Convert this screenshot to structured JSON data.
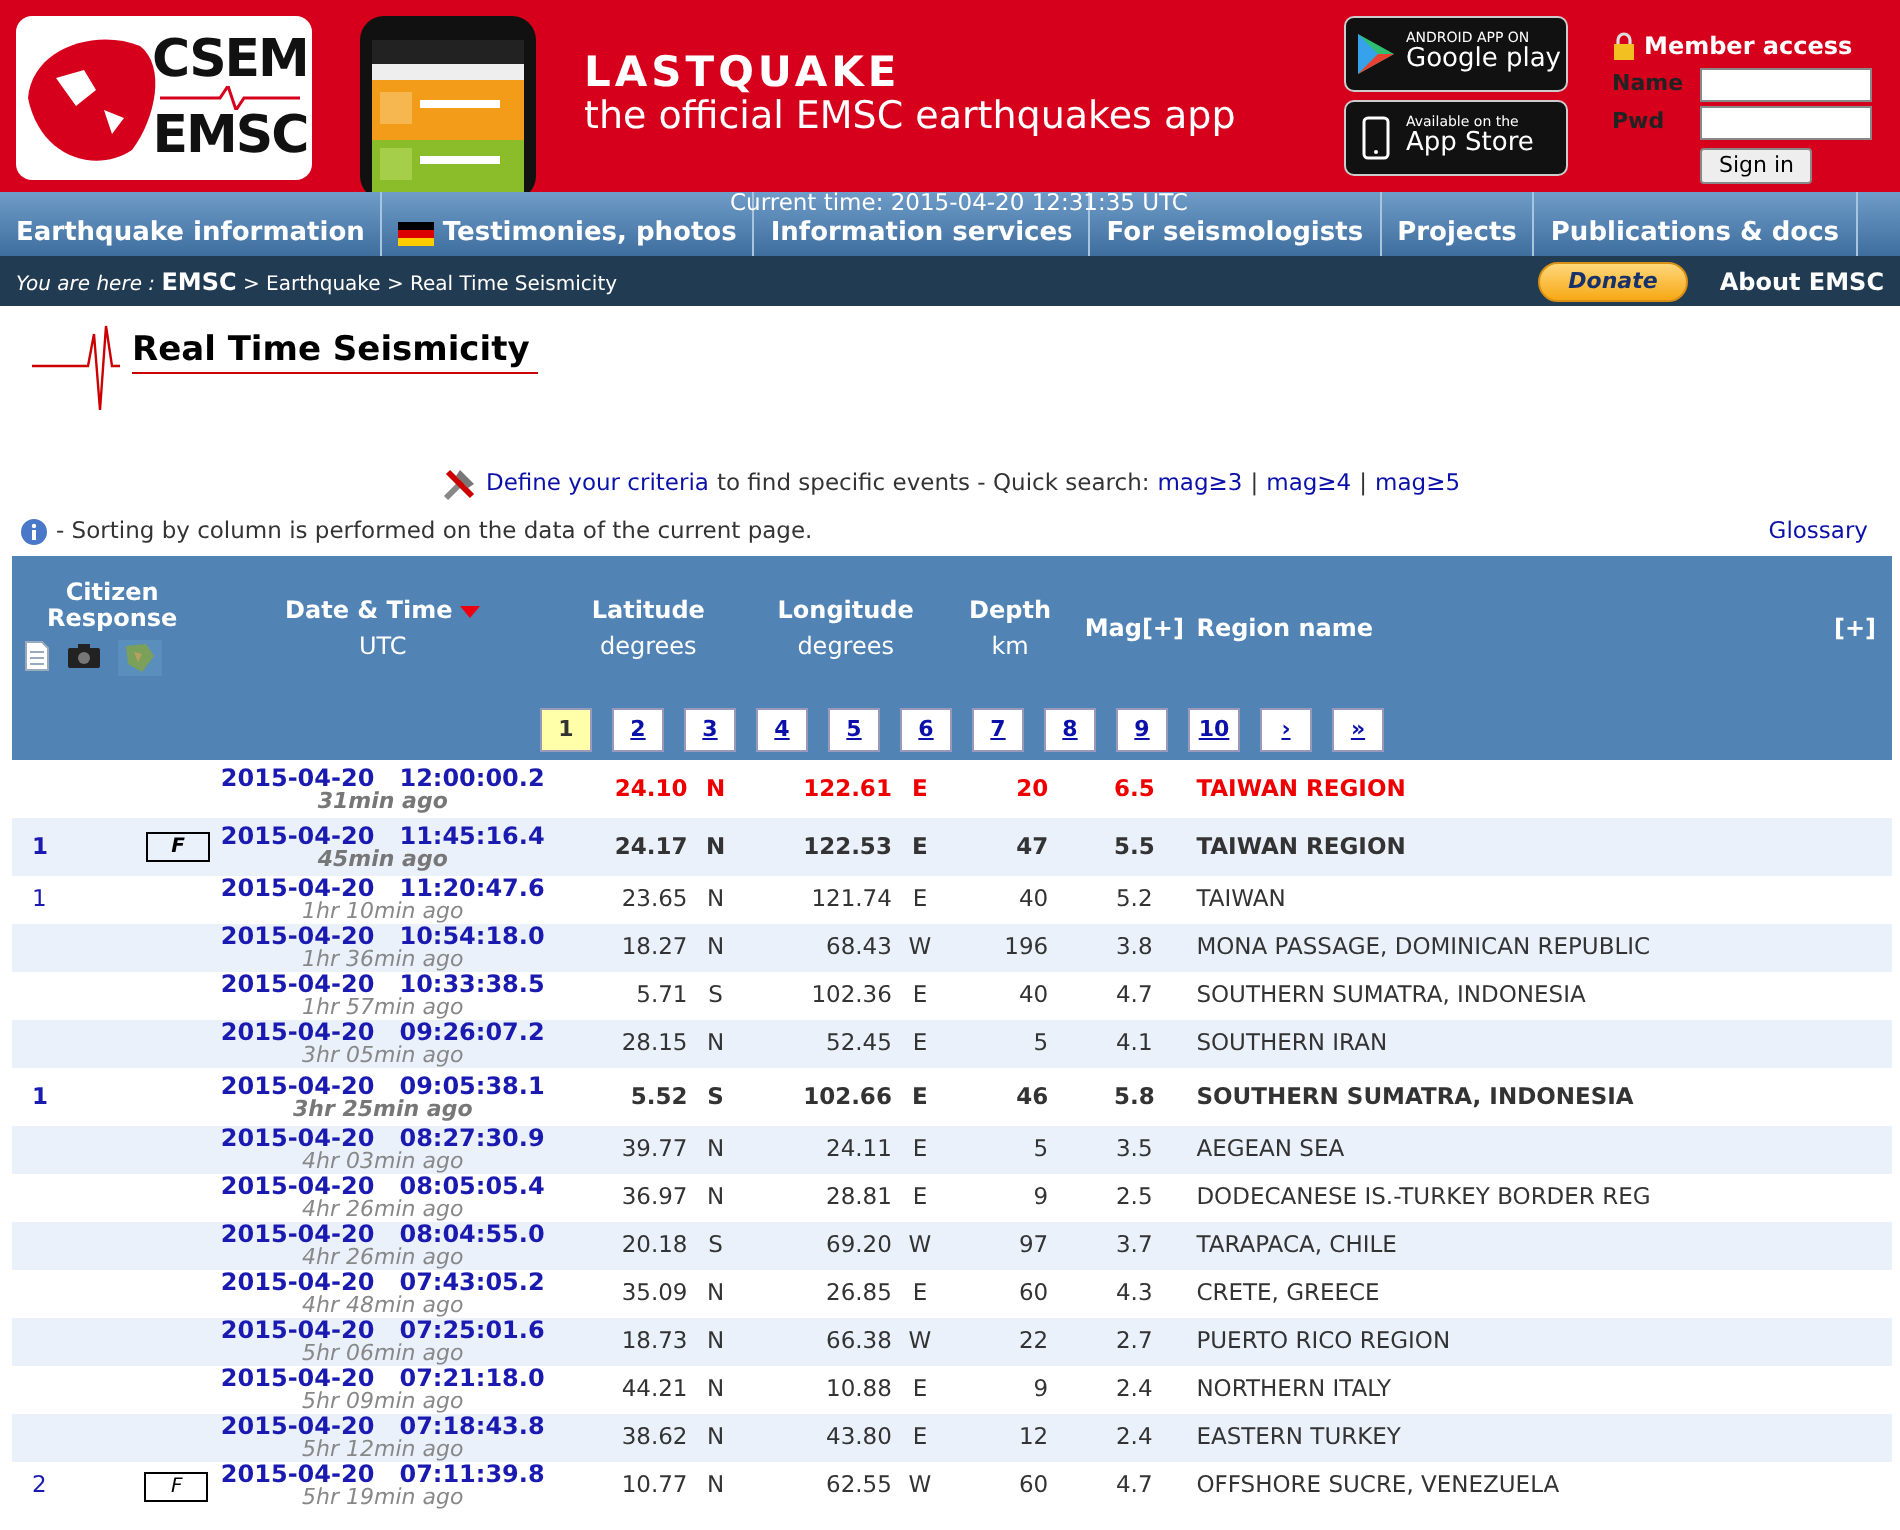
{
  "header": {
    "logo_top": "CSEM",
    "logo_bottom": "EMSC",
    "app_title": "LASTQUAKE",
    "app_subtitle": "the official EMSC earthquakes app",
    "stores": [
      {
        "kind": "google",
        "small": "ANDROID APP ON",
        "big": "Google play"
      },
      {
        "kind": "apple",
        "small": "Available on the",
        "big": "App Store"
      }
    ],
    "member": {
      "title": "Member access",
      "name_label": "Name",
      "pwd_label": "Pwd",
      "button": "Sign in"
    }
  },
  "current_time": "Current time: 2015-04-20 12:31:35 UTC",
  "nav": [
    {
      "label": "Earthquake information",
      "flag": false
    },
    {
      "label": "Testimonies, photos",
      "flag": true
    },
    {
      "label": "Information services",
      "flag": false
    },
    {
      "label": "For seismologists",
      "flag": false
    },
    {
      "label": "Projects",
      "flag": false
    },
    {
      "label": "Publications & docs",
      "flag": false
    }
  ],
  "breadcrumb": {
    "prefix": "You are here :",
    "items": [
      "EMSC",
      "Earthquake",
      "Real Time Seismicity"
    ],
    "separator": ">",
    "donate": "Donate",
    "about": "About EMSC"
  },
  "page_title": "Real Time Seismicity",
  "criteria": {
    "link": "Define your criteria",
    "text": "to find specific events - Quick search:",
    "quick": [
      "mag≥3",
      "mag≥4",
      "mag≥5"
    ],
    "separator": "|"
  },
  "info": "- Sorting by column is performed on the data of the current page.",
  "glossary": "Glossary",
  "table": {
    "columns": [
      {
        "title": "Citizen Response"
      },
      {
        "title": "Date & Time",
        "sub": "UTC",
        "sorted": true
      },
      {
        "title": "Latitude",
        "sub": "degrees"
      },
      {
        "title": "Longitude",
        "sub": "degrees"
      },
      {
        "title": "Depth",
        "sub": "km"
      },
      {
        "title": "Mag[+]"
      },
      {
        "title": "Region name"
      },
      {
        "title": "[+]"
      }
    ],
    "pages": [
      {
        "label": "1",
        "selected": true
      },
      {
        "label": "2",
        "selected": false
      },
      {
        "label": "3",
        "selected": false
      },
      {
        "label": "4",
        "selected": false
      },
      {
        "label": "5",
        "selected": false
      },
      {
        "label": "6",
        "selected": false
      },
      {
        "label": "7",
        "selected": false
      },
      {
        "label": "8",
        "selected": false
      },
      {
        "label": "9",
        "selected": false
      },
      {
        "label": "10",
        "selected": false
      },
      {
        "label": "›",
        "selected": false
      },
      {
        "label": "»",
        "selected": false
      }
    ],
    "rows": [
      {
        "latest": true,
        "bold": true,
        "datetime": "2015-04-20   12:00:00.2",
        "ago": "31min ago",
        "lat": "24.10",
        "ns": "N",
        "lon": "122.61",
        "ew": "E",
        "depth": "20",
        "mag": "6.5",
        "region": "TAIWAN REGION"
      },
      {
        "latest": false,
        "bold": true,
        "count": "1",
        "felt": "F",
        "datetime": "2015-04-20   11:45:16.4",
        "ago": "45min ago",
        "lat": "24.17",
        "ns": "N",
        "lon": "122.53",
        "ew": "E",
        "depth": "47",
        "mag": "5.5",
        "region": "TAIWAN REGION"
      },
      {
        "latest": false,
        "bold": false,
        "count": "1",
        "datetime": "2015-04-20   11:20:47.6",
        "ago": "1hr 10min ago",
        "lat": "23.65",
        "ns": "N",
        "lon": "121.74",
        "ew": "E",
        "depth": "40",
        "mag": "5.2",
        "region": "TAIWAN"
      },
      {
        "latest": false,
        "bold": false,
        "datetime": "2015-04-20   10:54:18.0",
        "ago": "1hr 36min ago",
        "lat": "18.27",
        "ns": "N",
        "lon": "68.43",
        "ew": "W",
        "depth": "196",
        "mag": "3.8",
        "region": "MONA PASSAGE, DOMINICAN REPUBLIC"
      },
      {
        "latest": false,
        "bold": false,
        "datetime": "2015-04-20   10:33:38.5",
        "ago": "1hr 57min ago",
        "lat": "5.71",
        "ns": "S",
        "lon": "102.36",
        "ew": "E",
        "depth": "40",
        "mag": "4.7",
        "region": "SOUTHERN SUMATRA, INDONESIA"
      },
      {
        "latest": false,
        "bold": false,
        "datetime": "2015-04-20   09:26:07.2",
        "ago": "3hr 05min ago",
        "lat": "28.15",
        "ns": "N",
        "lon": "52.45",
        "ew": "E",
        "depth": "5",
        "mag": "4.1",
        "region": "SOUTHERN IRAN"
      },
      {
        "latest": false,
        "bold": true,
        "count": "1",
        "datetime": "2015-04-20   09:05:38.1",
        "ago": "3hr 25min ago",
        "lat": "5.52",
        "ns": "S",
        "lon": "102.66",
        "ew": "E",
        "depth": "46",
        "mag": "5.8",
        "region": "SOUTHERN SUMATRA, INDONESIA"
      },
      {
        "latest": false,
        "bold": false,
        "datetime": "2015-04-20   08:27:30.9",
        "ago": "4hr 03min ago",
        "lat": "39.77",
        "ns": "N",
        "lon": "24.11",
        "ew": "E",
        "depth": "5",
        "mag": "3.5",
        "region": "AEGEAN SEA"
      },
      {
        "latest": false,
        "bold": false,
        "datetime": "2015-04-20   08:05:05.4",
        "ago": "4hr 26min ago",
        "lat": "36.97",
        "ns": "N",
        "lon": "28.81",
        "ew": "E",
        "depth": "9",
        "mag": "2.5",
        "region": "DODECANESE IS.-TURKEY BORDER REG"
      },
      {
        "latest": false,
        "bold": false,
        "datetime": "2015-04-20   08:04:55.0",
        "ago": "4hr 26min ago",
        "lat": "20.18",
        "ns": "S",
        "lon": "69.20",
        "ew": "W",
        "depth": "97",
        "mag": "3.7",
        "region": "TARAPACA, CHILE"
      },
      {
        "latest": false,
        "bold": false,
        "datetime": "2015-04-20   07:43:05.2",
        "ago": "4hr 48min ago",
        "lat": "35.09",
        "ns": "N",
        "lon": "26.85",
        "ew": "E",
        "depth": "60",
        "mag": "4.3",
        "region": "CRETE, GREECE"
      },
      {
        "latest": false,
        "bold": false,
        "datetime": "2015-04-20   07:25:01.6",
        "ago": "5hr 06min ago",
        "lat": "18.73",
        "ns": "N",
        "lon": "66.38",
        "ew": "W",
        "depth": "22",
        "mag": "2.7",
        "region": "PUERTO RICO REGION"
      },
      {
        "latest": false,
        "bold": false,
        "datetime": "2015-04-20   07:21:18.0",
        "ago": "5hr 09min ago",
        "lat": "44.21",
        "ns": "N",
        "lon": "10.88",
        "ew": "E",
        "depth": "9",
        "mag": "2.4",
        "region": "NORTHERN ITALY"
      },
      {
        "latest": false,
        "bold": false,
        "datetime": "2015-04-20   07:18:43.8",
        "ago": "5hr 12min ago",
        "lat": "38.62",
        "ns": "N",
        "lon": "43.80",
        "ew": "E",
        "depth": "12",
        "mag": "2.4",
        "region": "EASTERN TURKEY"
      },
      {
        "latest": false,
        "bold": false,
        "count": "2",
        "felt": "F",
        "datetime": "2015-04-20   07:11:39.8",
        "ago": "5hr 19min ago",
        "lat": "10.77",
        "ns": "N",
        "lon": "62.55",
        "ew": "W",
        "depth": "60",
        "mag": "4.7",
        "region": "OFFSHORE SUCRE, VENEZUELA"
      }
    ]
  }
}
